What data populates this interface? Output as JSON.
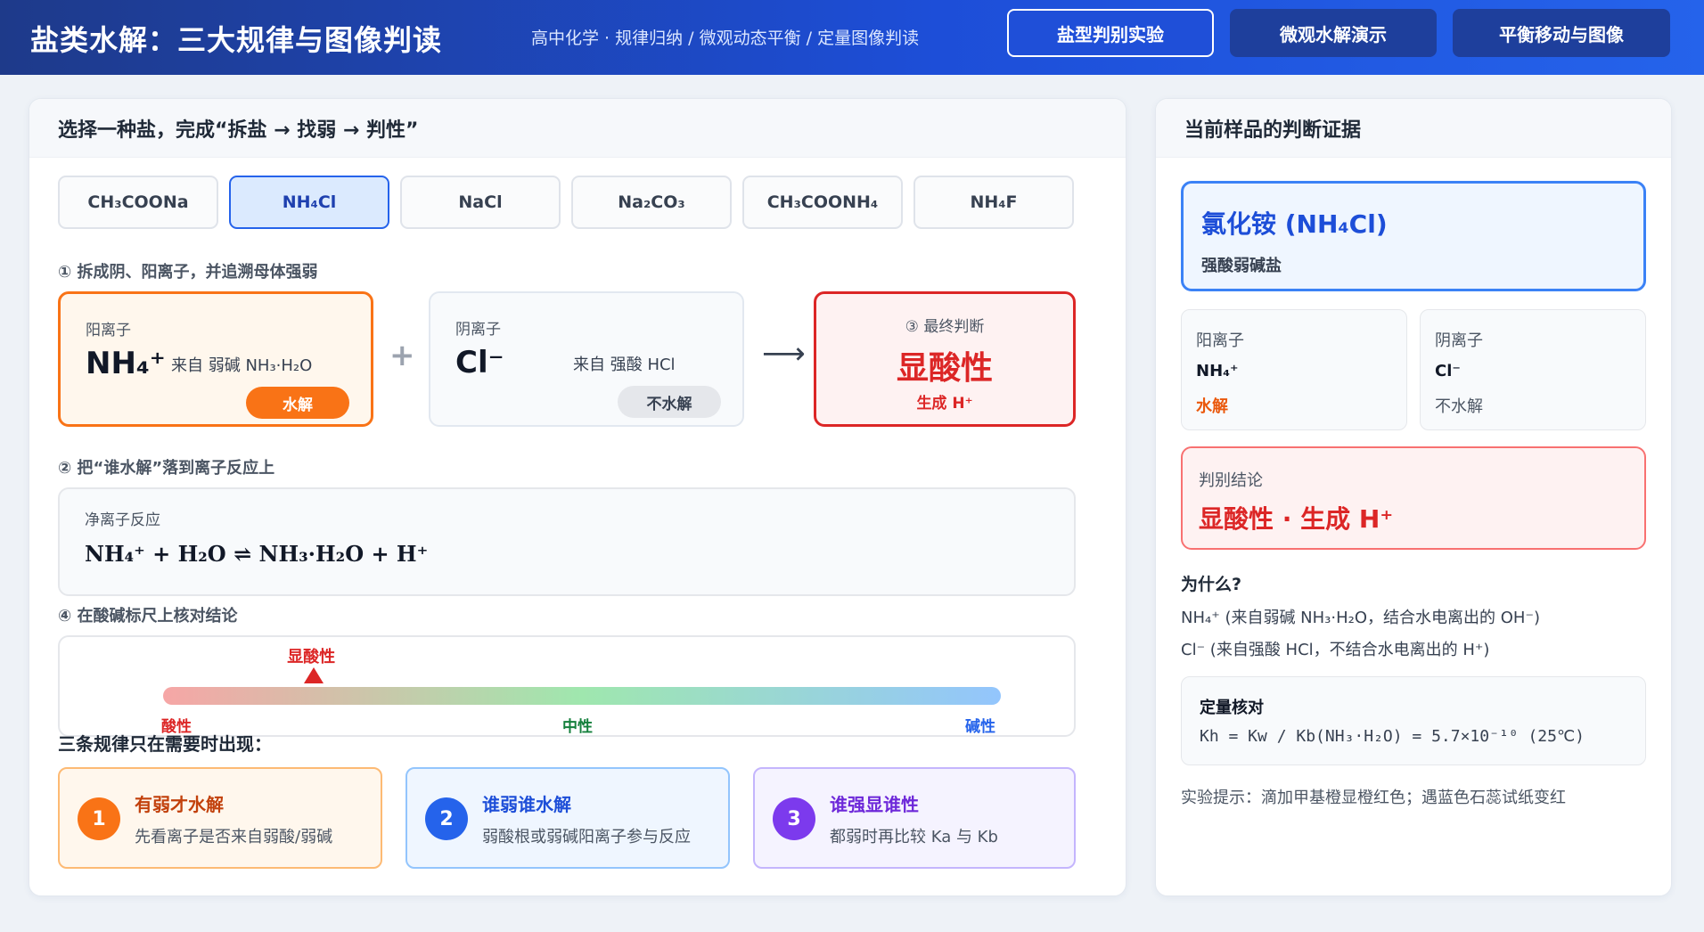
{
  "header": {
    "title": "盐类水解：三大规律与图像判读",
    "subtitle": "高中化学 · 规律归纳 / 微观动态平衡 / 定量图像判读",
    "nav": [
      {
        "label": "盐型判别实验",
        "active": true
      },
      {
        "label": "微观水解演示",
        "active": false
      },
      {
        "label": "平衡移动与图像",
        "active": false
      }
    ]
  },
  "left": {
    "title": "选择一种盐，完成“拆盐 → 找弱 → 判性”",
    "salts": [
      {
        "label": "CH₃COONa",
        "selected": false
      },
      {
        "label": "NH₄Cl",
        "selected": true
      },
      {
        "label": "NaCl",
        "selected": false
      },
      {
        "label": "Na₂CO₃",
        "selected": false
      },
      {
        "label": "CH₃COONH₄",
        "selected": false
      },
      {
        "label": "NH₄F",
        "selected": false
      }
    ],
    "step1": "① 拆成阴、阳离子，并追溯母体强弱",
    "cation": {
      "caption": "阳离子",
      "formula": "NH₄⁺",
      "origin": "来自 弱碱 NH₃·H₂O",
      "status": "水解"
    },
    "anion": {
      "caption": "阴离子",
      "formula": "Cl⁻",
      "origin": "来自 强酸 HCl",
      "status": "不水解"
    },
    "plus": "+",
    "arrow": "⟶",
    "verdict": {
      "caption": "③ 最终判断",
      "value": "显酸性",
      "detail": "生成 H⁺"
    },
    "step2": "② 把“谁水解”落到离子反应上",
    "reaction": {
      "caption": "净离子反应",
      "equation": "NH₄⁺ + H₂O ⇌ NH₃·H₂O + H⁺"
    },
    "step4": "④ 在酸碱标尺上核对结论",
    "scale": {
      "marker_label": "显酸性",
      "marker_position": 0.18,
      "ticks": [
        {
          "label": "酸性",
          "color": "#dc2626"
        },
        {
          "label": "中性",
          "color": "#15803d"
        },
        {
          "label": "碱性",
          "color": "#2563eb"
        }
      ]
    },
    "rules_title": "三条规律只在需要时出现：",
    "rules": [
      {
        "num": "1",
        "title": "有弱才水解",
        "desc": "先看离子是否来自弱酸/弱碱",
        "accent": "#f97316",
        "bg": "#fff7ed",
        "border": "#fdba74",
        "title_color": "#c2410c"
      },
      {
        "num": "2",
        "title": "谁弱谁水解",
        "desc": "弱酸根或弱碱阳离子参与反应",
        "accent": "#2563eb",
        "bg": "#eff6ff",
        "border": "#93c5fd",
        "title_color": "#1d4ed8"
      },
      {
        "num": "3",
        "title": "谁强显谁性",
        "desc": "都弱时再比较 Ka 与 Kb",
        "accent": "#7c3aed",
        "bg": "#f5f3ff",
        "border": "#c4b5fd",
        "title_color": "#6d28d9"
      }
    ]
  },
  "right": {
    "title": "当前样品的判断证据",
    "compound": {
      "name": "氯化铵 (NH₄Cl)",
      "type": "强酸弱碱盐"
    },
    "cation": {
      "caption": "阳离子",
      "ion": "NH₄⁺",
      "status": "水解",
      "status_color": "#ea580c"
    },
    "anion": {
      "caption": "阴离子",
      "ion": "Cl⁻",
      "status": "不水解",
      "status_color": "#4b5563"
    },
    "conclusion": {
      "caption": "判别结论",
      "value": "显酸性 · 生成 H⁺"
    },
    "why": {
      "title": "为什么?",
      "lines": [
        "NH₄⁺ (来自弱碱 NH₃·H₂O，结合水电离出的 OH⁻)",
        "Cl⁻ (来自强酸 HCl，不结合水电离出的 H⁺)"
      ]
    },
    "quant": {
      "caption": "定量核对",
      "value": "Kh = Kw / Kb(NH₃·H₂O) = 5.7×10⁻¹⁰ (25℃)"
    },
    "tip": "实验提示：滴加甲基橙显橙红色；遇蓝色石蕊试纸变红"
  }
}
